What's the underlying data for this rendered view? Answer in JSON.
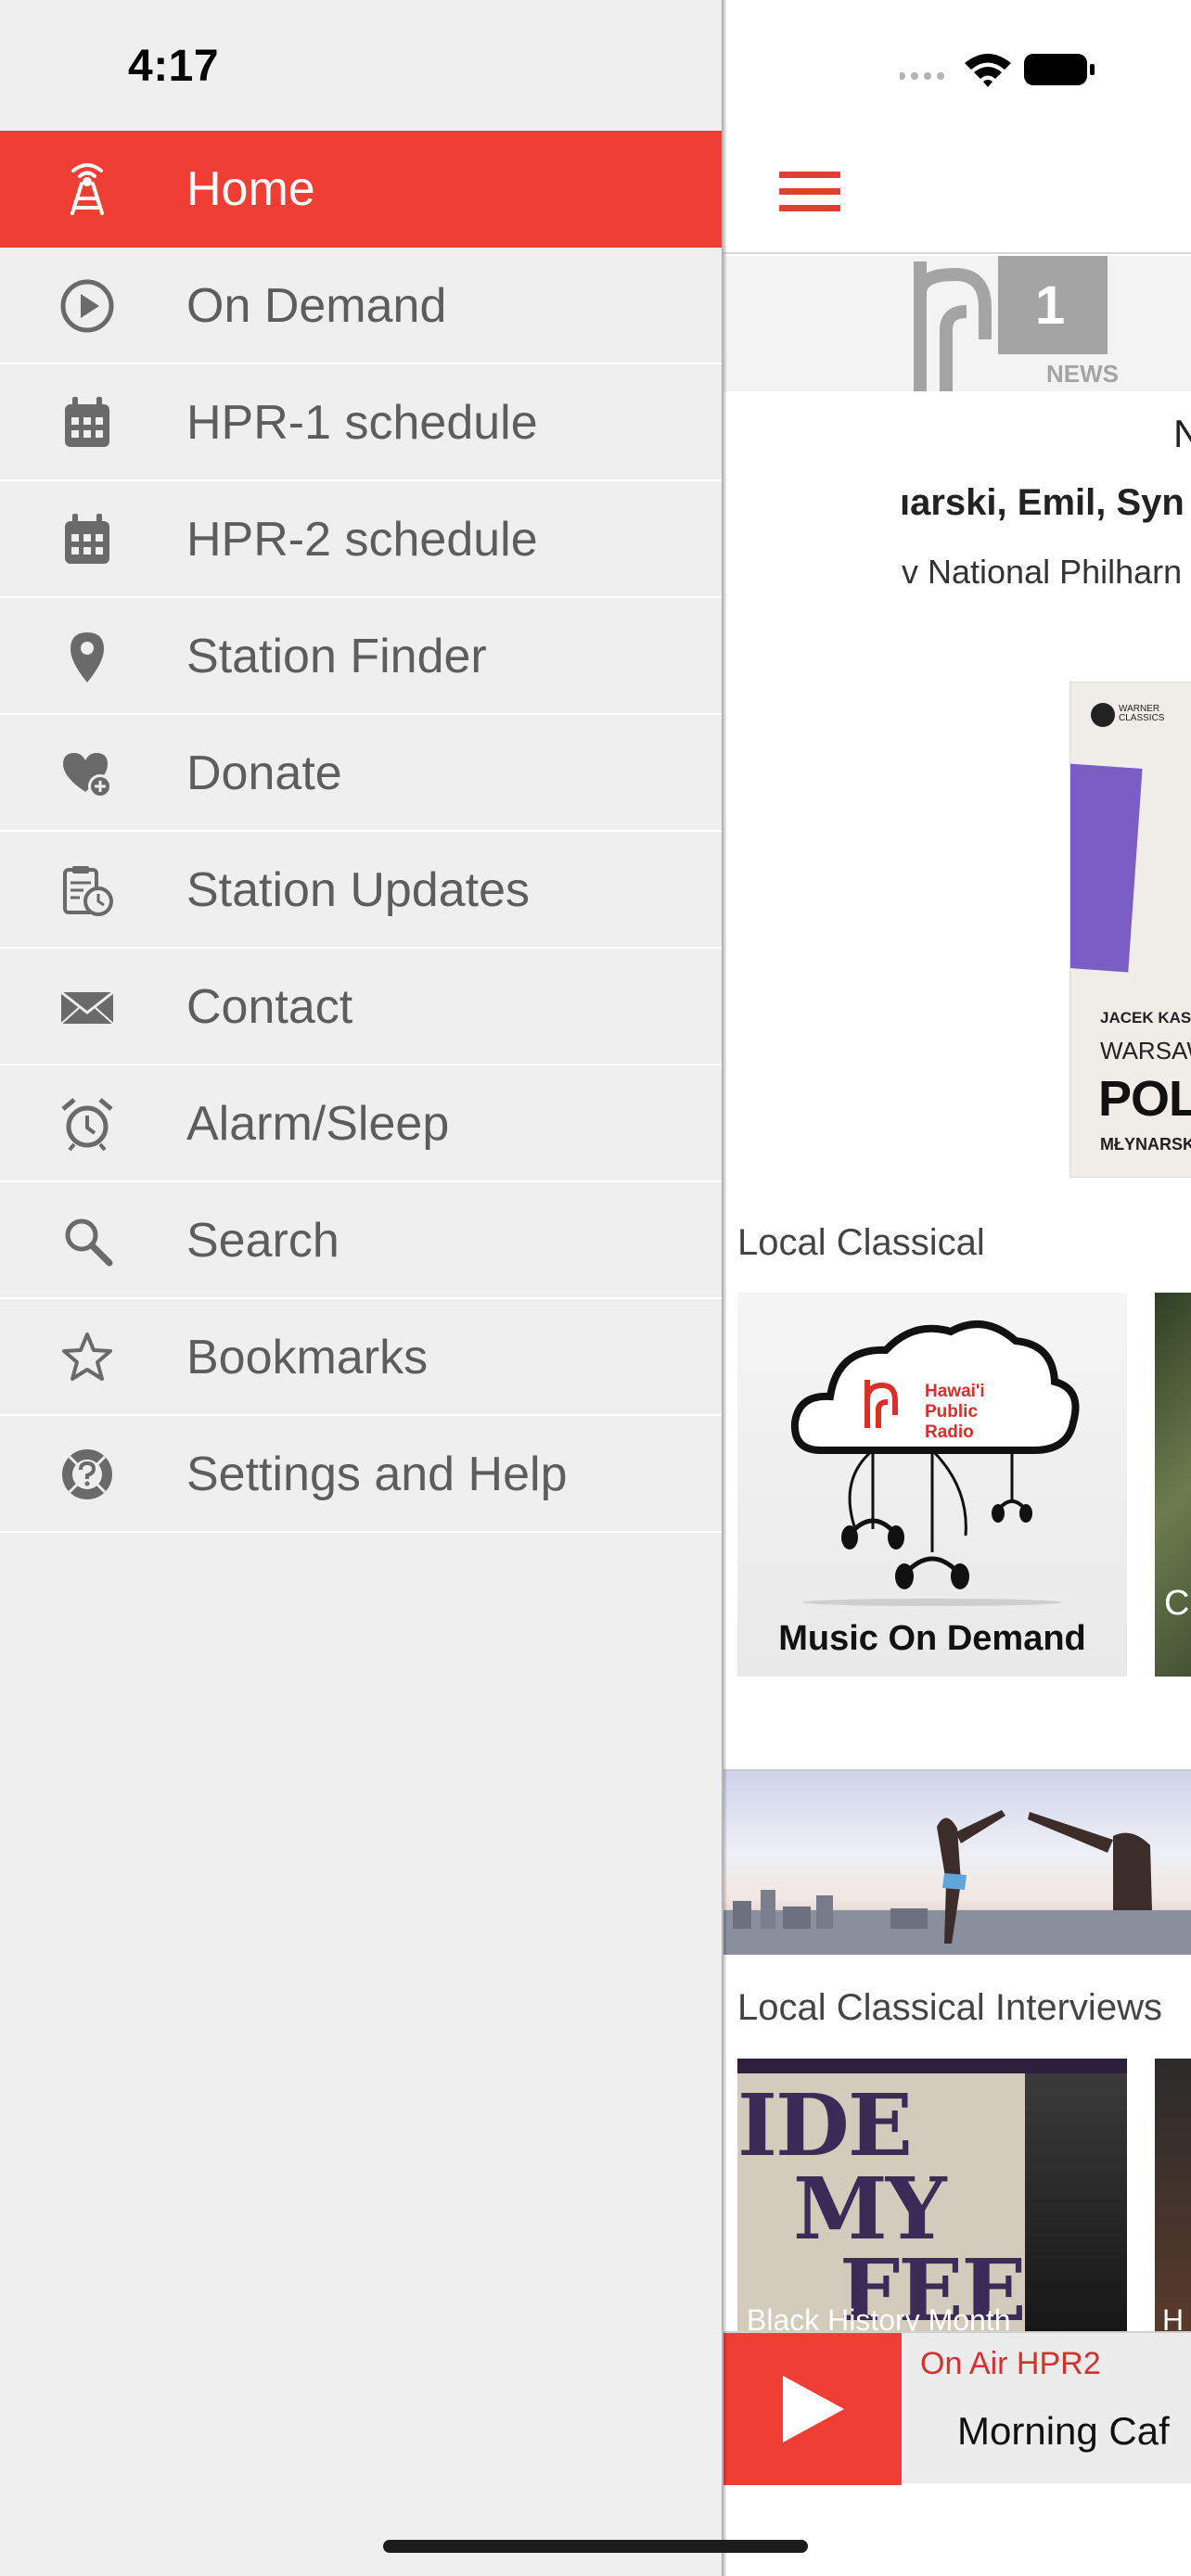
{
  "status_bar": {
    "time": "4:17"
  },
  "drawer": {
    "accent_color": "#ef3f35",
    "items": [
      {
        "label": "Home",
        "icon": "radio-tower-icon",
        "active": true
      },
      {
        "label": "On Demand",
        "icon": "play-circle-icon",
        "active": false
      },
      {
        "label": "HPR-1 schedule",
        "icon": "calendar-icon",
        "active": false
      },
      {
        "label": "HPR-2 schedule",
        "icon": "calendar-icon",
        "active": false
      },
      {
        "label": "Station Finder",
        "icon": "map-pin-icon",
        "active": false
      },
      {
        "label": "Donate",
        "icon": "heart-plus-icon",
        "active": false
      },
      {
        "label": "Station Updates",
        "icon": "clipboard-clock-icon",
        "active": false
      },
      {
        "label": "Contact",
        "icon": "envelope-icon",
        "active": false
      },
      {
        "label": "Alarm/Sleep",
        "icon": "alarm-clock-icon",
        "active": false
      },
      {
        "label": "Search",
        "icon": "search-icon",
        "active": false
      },
      {
        "label": "Bookmarks",
        "icon": "star-icon",
        "active": false
      },
      {
        "label": "Settings and Help",
        "icon": "help-circle-icon",
        "active": false
      }
    ]
  },
  "main": {
    "logo": {
      "number": "1",
      "subtitle": "NEWS"
    },
    "now_playing": {
      "title": "N",
      "artist": "ıarski, Emil, Syn",
      "ensemble": "v National Philharn"
    },
    "album_art": {
      "label_brand": "WARNER CLASSICS",
      "line1": "JACEK KASPS",
      "line2": "WARSAW P",
      "line3": "POLIS",
      "line4": "MŁYNARSKI ·"
    },
    "sections": [
      {
        "title": "Local Classical",
        "tiles": [
          {
            "caption": "Music On Demand",
            "brand": "Hawai'i Public Radio"
          },
          {
            "caption": "C"
          }
        ]
      },
      {
        "title": "Local Classical Interviews",
        "tiles": [
          {
            "caption": "Black History Month",
            "art_words": [
              "IDE",
              "MY",
              "FEET"
            ]
          },
          {
            "caption": "H"
          }
        ]
      }
    ],
    "player": {
      "on_air": "On Air HPR2",
      "program": "Morning Caf"
    }
  }
}
